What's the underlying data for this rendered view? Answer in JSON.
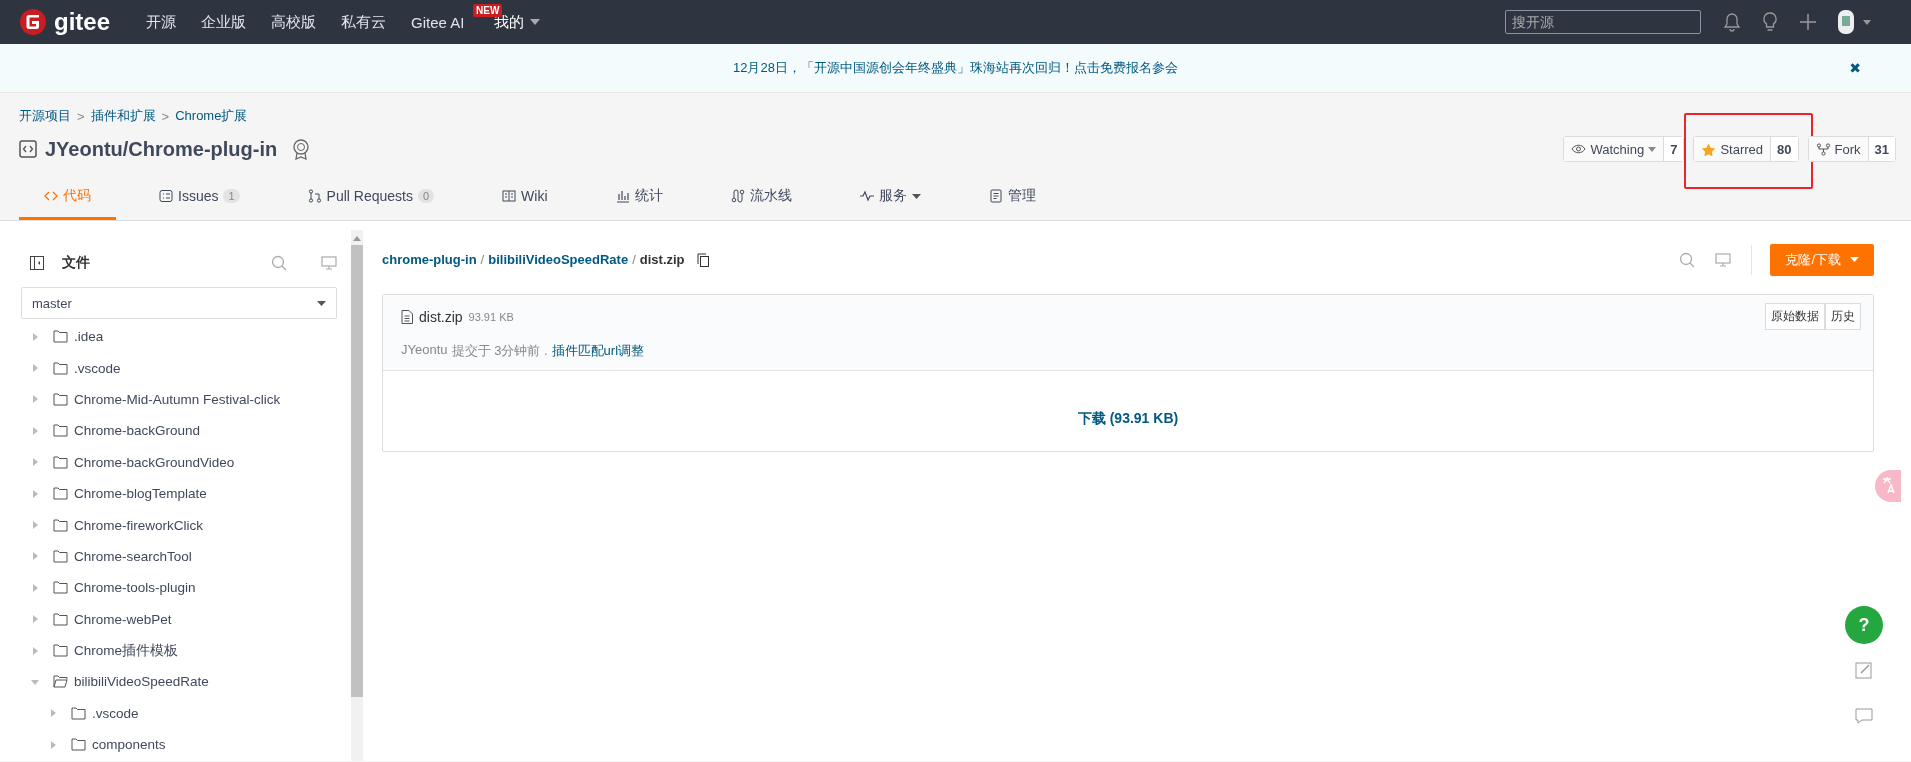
{
  "nav": {
    "logo": "gitee",
    "items": [
      {
        "label": "开源"
      },
      {
        "label": "企业版"
      },
      {
        "label": "高校版"
      },
      {
        "label": "私有云"
      },
      {
        "label": "Gitee AI",
        "badge": "NEW"
      }
    ],
    "mine": "我的",
    "search": {
      "placeholder": "搜开源"
    }
  },
  "banner": {
    "text": "12月28日，「开源中国源创会年终盛典」珠海站再次回归！点击免费报名参会",
    "close": "✖"
  },
  "breadcrumb": [
    {
      "label": "开源项目"
    },
    {
      "separator": ">",
      "label": "插件和扩展"
    },
    {
      "separator": ">",
      "label": "Chrome扩展"
    }
  ],
  "repo": {
    "title": "JYeontu/Chrome-plug-in"
  },
  "actions": [
    {
      "kind": "watch",
      "label": "Watching",
      "count": "7",
      "highlighted": false
    },
    {
      "kind": "star",
      "label": "Starred",
      "count": "80",
      "highlighted": true
    },
    {
      "kind": "fork",
      "label": "Fork",
      "count": "31",
      "highlighted": false
    }
  ],
  "tabs": [
    {
      "kind": "code",
      "label": "代码",
      "selected": true
    },
    {
      "kind": "issues",
      "label": "Issues",
      "count": "1",
      "selected": false
    },
    {
      "kind": "pr",
      "label": "Pull Requests",
      "count": "0",
      "selected": false
    },
    {
      "kind": "wiki",
      "label": "Wiki",
      "selected": false
    },
    {
      "kind": "stats",
      "label": "统计",
      "selected": false
    },
    {
      "kind": "pipeline",
      "label": "流水线",
      "selected": false
    },
    {
      "kind": "service",
      "label": "服务",
      "selected": false
    },
    {
      "kind": "manage",
      "label": "管理",
      "selected": false
    }
  ],
  "sidebar": {
    "title": "文件",
    "branch": "master",
    "tree": [
      {
        "name": ".idea",
        "expanded": false
      },
      {
        "name": ".vscode",
        "expanded": false
      },
      {
        "name": "Chrome-Mid-Autumn Festival-click",
        "expanded": false
      },
      {
        "name": "Chrome-backGround",
        "expanded": false
      },
      {
        "name": "Chrome-backGroundVideo",
        "expanded": false
      },
      {
        "name": "Chrome-blogTemplate",
        "expanded": false
      },
      {
        "name": "Chrome-fireworkClick",
        "expanded": false
      },
      {
        "name": "Chrome-searchTool",
        "expanded": false
      },
      {
        "name": "Chrome-tools-plugin",
        "expanded": false
      },
      {
        "name": "Chrome-webPet",
        "expanded": false
      },
      {
        "name": "Chrome插件模板",
        "expanded": false
      },
      {
        "name": "bilibiliVideoSpeedRate",
        "expanded": true,
        "children": [
          {
            "name": ".vscode",
            "expanded": false
          },
          {
            "name": "components",
            "expanded": false
          }
        ]
      }
    ]
  },
  "path": {
    "parts": [
      {
        "label": "chrome-plug-in",
        "separator": "/"
      },
      {
        "label": "bilibiliVideoSpeedRate",
        "separator": "/"
      }
    ],
    "file": "dist.zip"
  },
  "clone_button": "克隆/下载",
  "file": {
    "name": "dist.zip",
    "size": "93.91 KB",
    "raw": "原始数据",
    "history": "历史",
    "author": "JYeontu",
    "commit_meta": "提交于 3分钟前 .",
    "commit_message": "插件匹配url调整",
    "download": "下载 (93.91 KB)"
  },
  "help": "?"
}
